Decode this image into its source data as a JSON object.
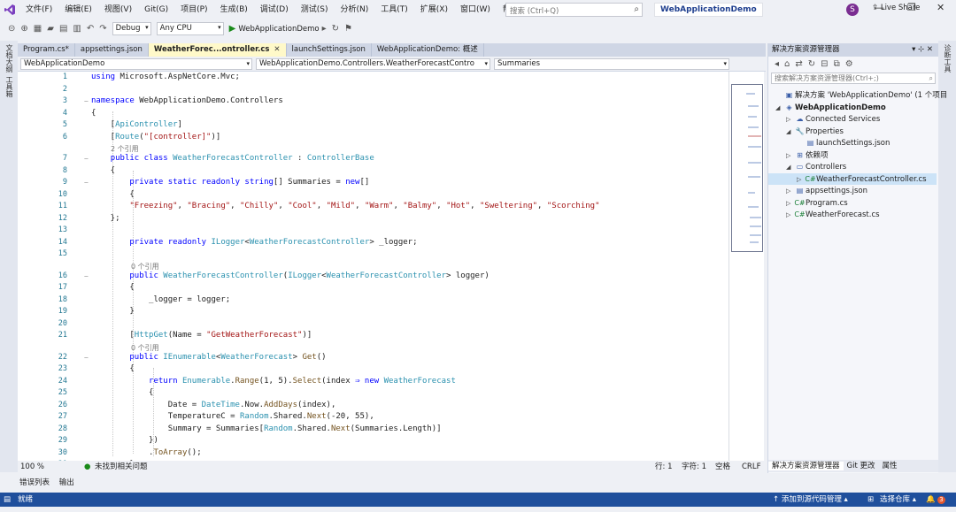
{
  "menu": [
    "文件(F)",
    "编辑(E)",
    "视图(V)",
    "Git(G)",
    "项目(P)",
    "生成(B)",
    "调试(D)",
    "测试(S)",
    "分析(N)",
    "工具(T)",
    "扩展(X)",
    "窗口(W)",
    "帮助(H)"
  ],
  "search": {
    "placeholder": "搜索 (Ctrl+Q)"
  },
  "solution_name": "WebApplicationDemo",
  "user_initial": "S",
  "toolbar": {
    "config": "Debug",
    "platform": "Any CPU",
    "run_target": "WebApplicationDemo",
    "live_share": "Live Share"
  },
  "left_strip": [
    "文档大纲",
    "工具箱"
  ],
  "right_strip": [
    "诊断工具"
  ],
  "tabs": [
    {
      "label": "Program.cs*",
      "active": false
    },
    {
      "label": "appsettings.json",
      "active": false
    },
    {
      "label": "WeatherForec...ontroller.cs",
      "active": true
    },
    {
      "label": "launchSettings.json",
      "active": false
    },
    {
      "label": "WebApplicationDemo: 概述",
      "active": false
    }
  ],
  "nav": {
    "project": "WebApplicationDemo",
    "class": "WebApplicationDemo.Controllers.WeatherForecastContro",
    "member": "Summaries"
  },
  "code": [
    {
      "n": "1",
      "html": "<span class='kw'>using</span> Microsoft.AspNetCore.Mvc;"
    },
    {
      "n": "2",
      "html": ""
    },
    {
      "n": "3",
      "html": "<span class='kw'>namespace</span> WebApplicationDemo.Controllers"
    },
    {
      "n": "4",
      "html": "{"
    },
    {
      "n": "5",
      "html": "    [<span class='at'>ApiController</span>]"
    },
    {
      "n": "6",
      "html": "    [<span class='at'>Route</span>(<span class='st'>\"[controller]\"</span>)]"
    },
    {
      "ref": "2 个引用"
    },
    {
      "n": "7",
      "html": "    <span class='kw'>public class</span> <span class='ty'>WeatherForecastController</span> : <span class='ty'>ControllerBase</span>"
    },
    {
      "n": "8",
      "html": "    {"
    },
    {
      "n": "9",
      "html": "        <span class='kw'>private static readonly string</span>[] Summaries = <span class='kw'>new</span>[]"
    },
    {
      "n": "10",
      "html": "        {"
    },
    {
      "n": "11",
      "html": "        <span class='st'>\"Freezing\"</span>, <span class='st'>\"Bracing\"</span>, <span class='st'>\"Chilly\"</span>, <span class='st'>\"Cool\"</span>, <span class='st'>\"Mild\"</span>, <span class='st'>\"Warm\"</span>, <span class='st'>\"Balmy\"</span>, <span class='st'>\"Hot\"</span>, <span class='st'>\"Sweltering\"</span>, <span class='st'>\"Scorching\"</span>"
    },
    {
      "n": "12",
      "html": "    };"
    },
    {
      "n": "13",
      "html": ""
    },
    {
      "n": "14",
      "html": "        <span class='kw'>private readonly</span> <span class='ty'>ILogger</span>&lt;<span class='ty'>WeatherForecastController</span>&gt; _logger;"
    },
    {
      "n": "15",
      "html": ""
    },
    {
      "ref": "0 个引用"
    },
    {
      "n": "16",
      "html": "        <span class='kw'>public</span> <span class='ty'>WeatherForecastController</span>(<span class='ty'>ILogger</span>&lt;<span class='ty'>WeatherForecastController</span>&gt; logger)"
    },
    {
      "n": "17",
      "html": "        {"
    },
    {
      "n": "18",
      "html": "            _logger = logger;"
    },
    {
      "n": "19",
      "html": "        }"
    },
    {
      "n": "20",
      "html": ""
    },
    {
      "n": "21",
      "html": "        [<span class='at'>HttpGet</span>(Name = <span class='st'>\"GetWeatherForecast\"</span>)]"
    },
    {
      "ref": "0 个引用"
    },
    {
      "n": "22",
      "html": "        <span class='kw'>public</span> <span class='ty'>IEnumerable</span>&lt;<span class='ty'>WeatherForecast</span>&gt; <span class='mt'>Get</span>()"
    },
    {
      "n": "23",
      "html": "        {"
    },
    {
      "n": "24",
      "html": "            <span class='kw'>return</span> <span class='ty'>Enumerable</span>.<span class='mt'>Range</span>(1, 5).<span class='mt'>Select</span>(index <span class='kw'>⇒</span> <span class='kw'>new</span> <span class='ty'>WeatherForecast</span>"
    },
    {
      "n": "25",
      "html": "            {"
    },
    {
      "n": "26",
      "html": "                Date = <span class='ty'>DateTime</span>.Now.<span class='mt'>AddDays</span>(index),"
    },
    {
      "n": "27",
      "html": "                TemperatureC = <span class='ty'>Random</span>.Shared.<span class='mt'>Next</span>(-20, 55),"
    },
    {
      "n": "28",
      "html": "                Summary = Summaries[<span class='ty'>Random</span>.Shared.<span class='mt'>Next</span>(Summaries.Length)]"
    },
    {
      "n": "29",
      "html": "            })"
    },
    {
      "n": "30",
      "html": "            .<span class='mt'>ToArray</span>();"
    },
    {
      "n": "31",
      "html": "        }"
    }
  ],
  "editor_status": {
    "zoom": "100 %",
    "issues": "未找到相关问题",
    "line": "行: 1",
    "col": "字符: 1",
    "spaces": "空格",
    "eol": "CRLF"
  },
  "solution_explorer": {
    "title": "解决方案资源管理器",
    "search_placeholder": "搜索解决方案资源管理器(Ctrl+;)",
    "items": [
      {
        "label": "解决方案 'WebApplicationDemo' (1 个项目",
        "level": 0,
        "icon": "▣",
        "exp": ""
      },
      {
        "label": "WebApplicationDemo",
        "level": 0,
        "icon": "◈",
        "exp": "◢",
        "bold": true
      },
      {
        "label": "Connected Services",
        "level": 1,
        "icon": "☁",
        "exp": "▷"
      },
      {
        "label": "Properties",
        "level": 1,
        "icon": "🔧",
        "exp": "◢"
      },
      {
        "label": "launchSettings.json",
        "level": 2,
        "icon": "▤",
        "exp": ""
      },
      {
        "label": "依赖项",
        "level": 1,
        "icon": "⊞",
        "exp": "▷"
      },
      {
        "label": "Controllers",
        "level": 1,
        "icon": "▭",
        "exp": "◢"
      },
      {
        "label": "WeatherForecastController.cs",
        "level": 2,
        "icon": "C#",
        "exp": "▷",
        "sel": true
      },
      {
        "label": "appsettings.json",
        "level": 1,
        "icon": "▤",
        "exp": "▷"
      },
      {
        "label": "Program.cs",
        "level": 1,
        "icon": "C#",
        "exp": "▷"
      },
      {
        "label": "WeatherForecast.cs",
        "level": 1,
        "icon": "C#",
        "exp": "▷"
      }
    ],
    "bottom_tabs": [
      "解决方案资源管理器",
      "Git 更改",
      "属性"
    ]
  },
  "output_tabs": [
    "错误列表",
    "输出"
  ],
  "status": {
    "ready": "就绪",
    "source_control": "↑ 添加到源代码管理 ▴",
    "repo": "选择仓库 ▴",
    "notif": "3"
  },
  "colors": {
    "accent": "#1f4f9c",
    "tab_active": "#fff9c9",
    "selection": "#cce3f7"
  }
}
